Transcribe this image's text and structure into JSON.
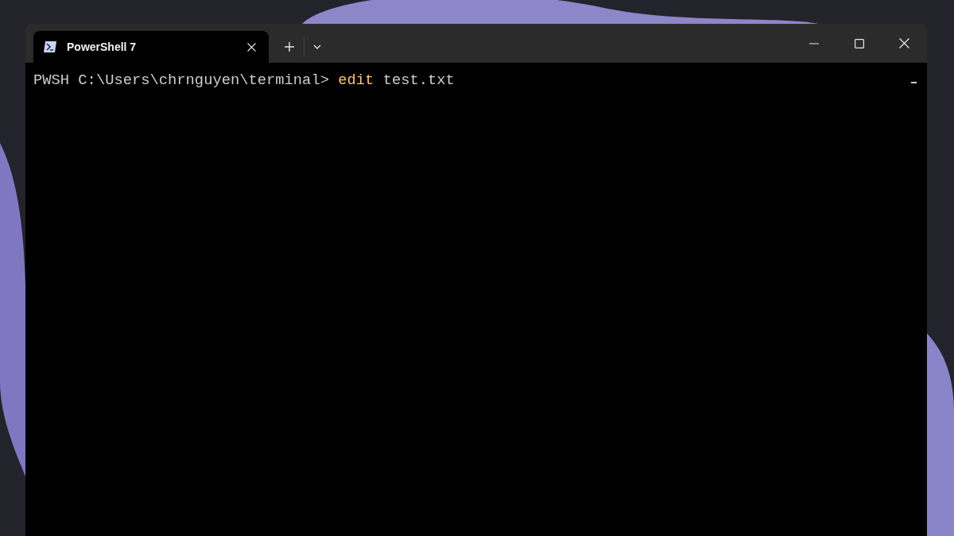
{
  "window": {
    "tabs": [
      {
        "title": "PowerShell 7",
        "selected": true
      }
    ]
  },
  "terminal": {
    "lines": [
      {
        "segments": [
          {
            "kind": "prompt",
            "text": "PWSH C:\\Users\\chrnguyen\\terminal>"
          },
          {
            "kind": "command",
            "text": "edit"
          },
          {
            "kind": "argument",
            "text": "test.txt"
          }
        ]
      }
    ]
  }
}
